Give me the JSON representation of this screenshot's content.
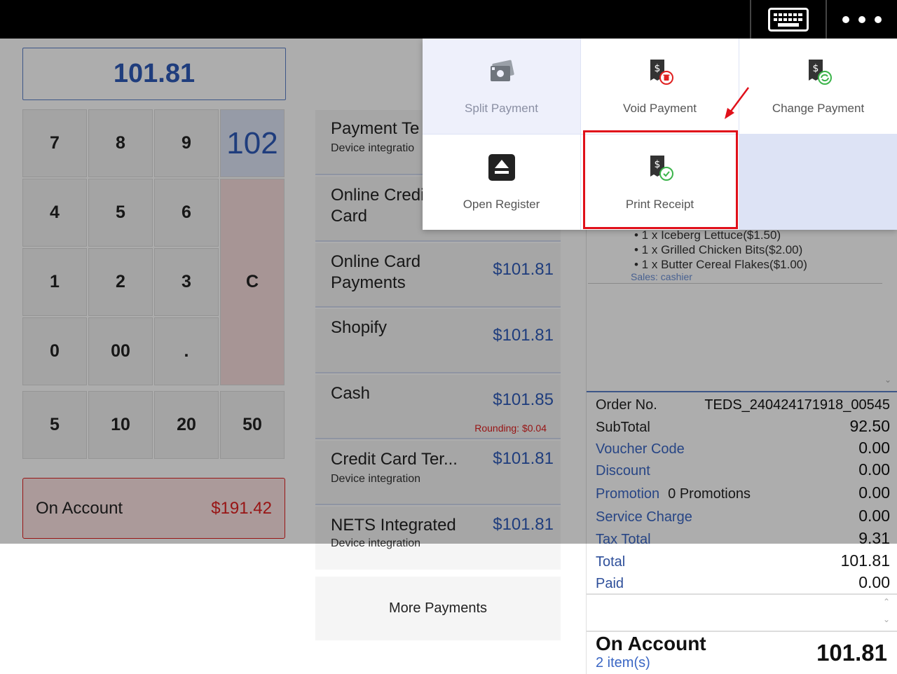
{
  "topbar": {
    "keyboard_icon": "keyboard-icon",
    "more_icon": "more-horizontal-icon"
  },
  "amount_display": "101.81",
  "keypad": {
    "keys": [
      "7",
      "8",
      "9",
      "102",
      "4",
      "5",
      "6",
      "1",
      "2",
      "3",
      "C",
      "0",
      "00",
      ".",
      "5",
      "10",
      "20",
      "50"
    ]
  },
  "on_account_btn": {
    "label": "On Account",
    "amount": "$191.42"
  },
  "payments": [
    {
      "name": "Payment Te",
      "sub": "Device integratio"
    },
    {
      "name": "Online Credi\nCard"
    },
    {
      "name": "Online Card\nPayments",
      "price": "$101.81"
    },
    {
      "name": "Shopify",
      "price": "$101.81"
    },
    {
      "name": "Cash",
      "price": "$101.85",
      "rounding": "Rounding: $0.04"
    },
    {
      "name": "Credit Card Ter...",
      "price": "$101.81",
      "sub": "Device integration"
    },
    {
      "name": "NETS Integrated",
      "price": "$101.81",
      "sub": "Device integration"
    }
  ],
  "more_payments": "More Payments",
  "receipt": {
    "modifiers": [
      "• 1 x Iceberg Lettuce($1.50)",
      "• 1 x Grilled Chicken Bits($2.00)",
      "• 1 x Butter Cereal Flakes($1.00)"
    ],
    "sales": "Sales: cashier",
    "order_no_label": "Order No.",
    "order_no": "TEDS_240424171918_00545",
    "subtotal_label": "SubTotal",
    "subtotal": "92.50",
    "voucher_label": "Voucher Code",
    "voucher": "0.00",
    "discount_label": "Discount",
    "discount": "0.00",
    "promotion_label": "Promotion",
    "promotion_count": "0 Promotions",
    "promotion": "0.00",
    "service_label": "Service Charge",
    "service": "0.00",
    "tax_label": "Tax Total",
    "tax": "9.31",
    "total_label": "Total",
    "total": "101.81",
    "paid_label": "Paid",
    "paid": "0.00",
    "on_account_label": "On Account",
    "items": "2 item(s)",
    "on_account_amount": "101.81"
  },
  "menu": {
    "split": "Split Payment",
    "void": "Void Payment",
    "change": "Change Payment",
    "open_register": "Open Register",
    "print_receipt": "Print Receipt"
  },
  "colors": {
    "accent_blue": "#2e5bb8",
    "danger_red": "#e02020",
    "highlight": "#e0101a"
  }
}
